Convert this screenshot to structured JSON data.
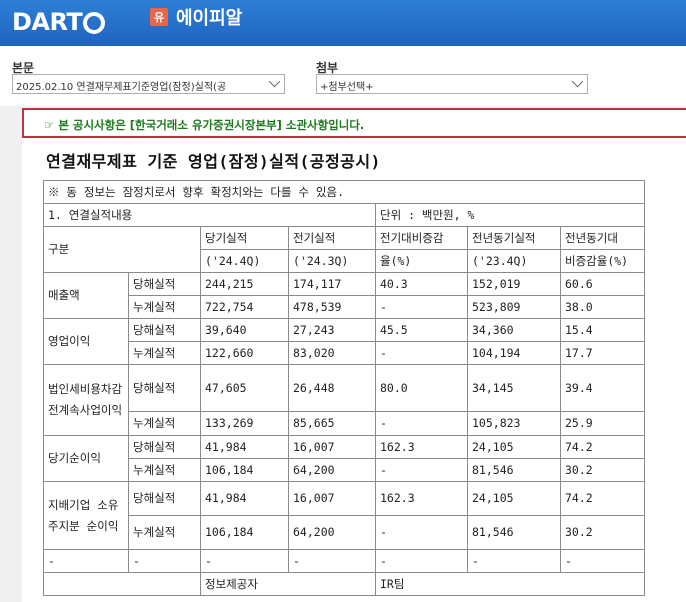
{
  "header": {
    "logo_text": "DART",
    "badge": "유",
    "company_name": "에이피알"
  },
  "selectors": {
    "report_label": "본문",
    "report_value": "2025.02.10  연결재무제표기준영업(잠정)실적(공",
    "attach_label": "첨부",
    "attach_value": "+첨부선택+"
  },
  "notice": "☞ 본 공시사항은 [한국거래소 유가증권시장본부] 소관사항입니다.",
  "title": "연결재무제표 기준 영업(잠정)실적(공정공시)",
  "table": {
    "disclaimer": "※ 동 정보는 잠정치로서 향후 확정치와는 다를 수 있음.",
    "section": "1. 연결실적내용",
    "unit": "단위 : 백만원, %",
    "headers": {
      "category": "구분",
      "cur": "당기실적",
      "cur_period": "('24.4Q)",
      "prev": "전기실적",
      "prev_period": "('24.3Q)",
      "qoq": "전기대비증감",
      "qoq2": "율(%)",
      "yoy_prev": "전년동기실적",
      "yoy_prev_period": "('23.4Q)",
      "yoy": "전년동기대",
      "yoy2": "비증감율(%)"
    },
    "groups": [
      {
        "label": "매출액",
        "rows": [
          {
            "type": "당해실적",
            "cur": "244,215",
            "prev": "174,117",
            "qoq": "40.3",
            "yoy_prev": "152,019",
            "yoy": "60.6"
          },
          {
            "type": "누계실적",
            "cur": "722,754",
            "prev": "478,539",
            "qoq": "-",
            "yoy_prev": "523,809",
            "yoy": "38.0"
          }
        ]
      },
      {
        "label": "영업이익",
        "rows": [
          {
            "type": "당해실적",
            "cur": "39,640",
            "prev": "27,243",
            "qoq": "45.5",
            "yoy_prev": "34,360",
            "yoy": "15.4"
          },
          {
            "type": "누계실적",
            "cur": "122,660",
            "prev": "83,020",
            "qoq": "-",
            "yoy_prev": "104,194",
            "yoy": "17.7"
          }
        ]
      },
      {
        "label": "법인세비용차감전계속사업이익",
        "rows": [
          {
            "type": "당해실적",
            "cur": "47,605",
            "prev": "26,448",
            "qoq": "80.0",
            "yoy_prev": "34,145",
            "yoy": "39.4"
          },
          {
            "type": "누계실적",
            "cur": "133,269",
            "prev": "85,665",
            "qoq": "-",
            "yoy_prev": "105,823",
            "yoy": "25.9"
          }
        ]
      },
      {
        "label": "당기순이익",
        "rows": [
          {
            "type": "당해실적",
            "cur": "41,984",
            "prev": "16,007",
            "qoq": "162.3",
            "yoy_prev": "24,105",
            "yoy": "74.2"
          },
          {
            "type": "누계실적",
            "cur": "106,184",
            "prev": "64,200",
            "qoq": "-",
            "yoy_prev": "81,546",
            "yoy": "30.2"
          }
        ]
      },
      {
        "label": "지배기업 소유주지분 순이익",
        "rows": [
          {
            "type": "당해실적",
            "cur": "41,984",
            "prev": "16,007",
            "qoq": "162.3",
            "yoy_prev": "24,105",
            "yoy": "74.2"
          },
          {
            "type": "누계실적",
            "cur": "106,184",
            "prev": "64,200",
            "qoq": "-",
            "yoy_prev": "81,546",
            "yoy": "30.2"
          }
        ]
      }
    ],
    "blank_row": [
      "-",
      "-",
      "-",
      "-",
      "-",
      "-",
      "-"
    ],
    "footer": {
      "provider_label": "정보제공자",
      "provider_value": "IR팀"
    }
  }
}
